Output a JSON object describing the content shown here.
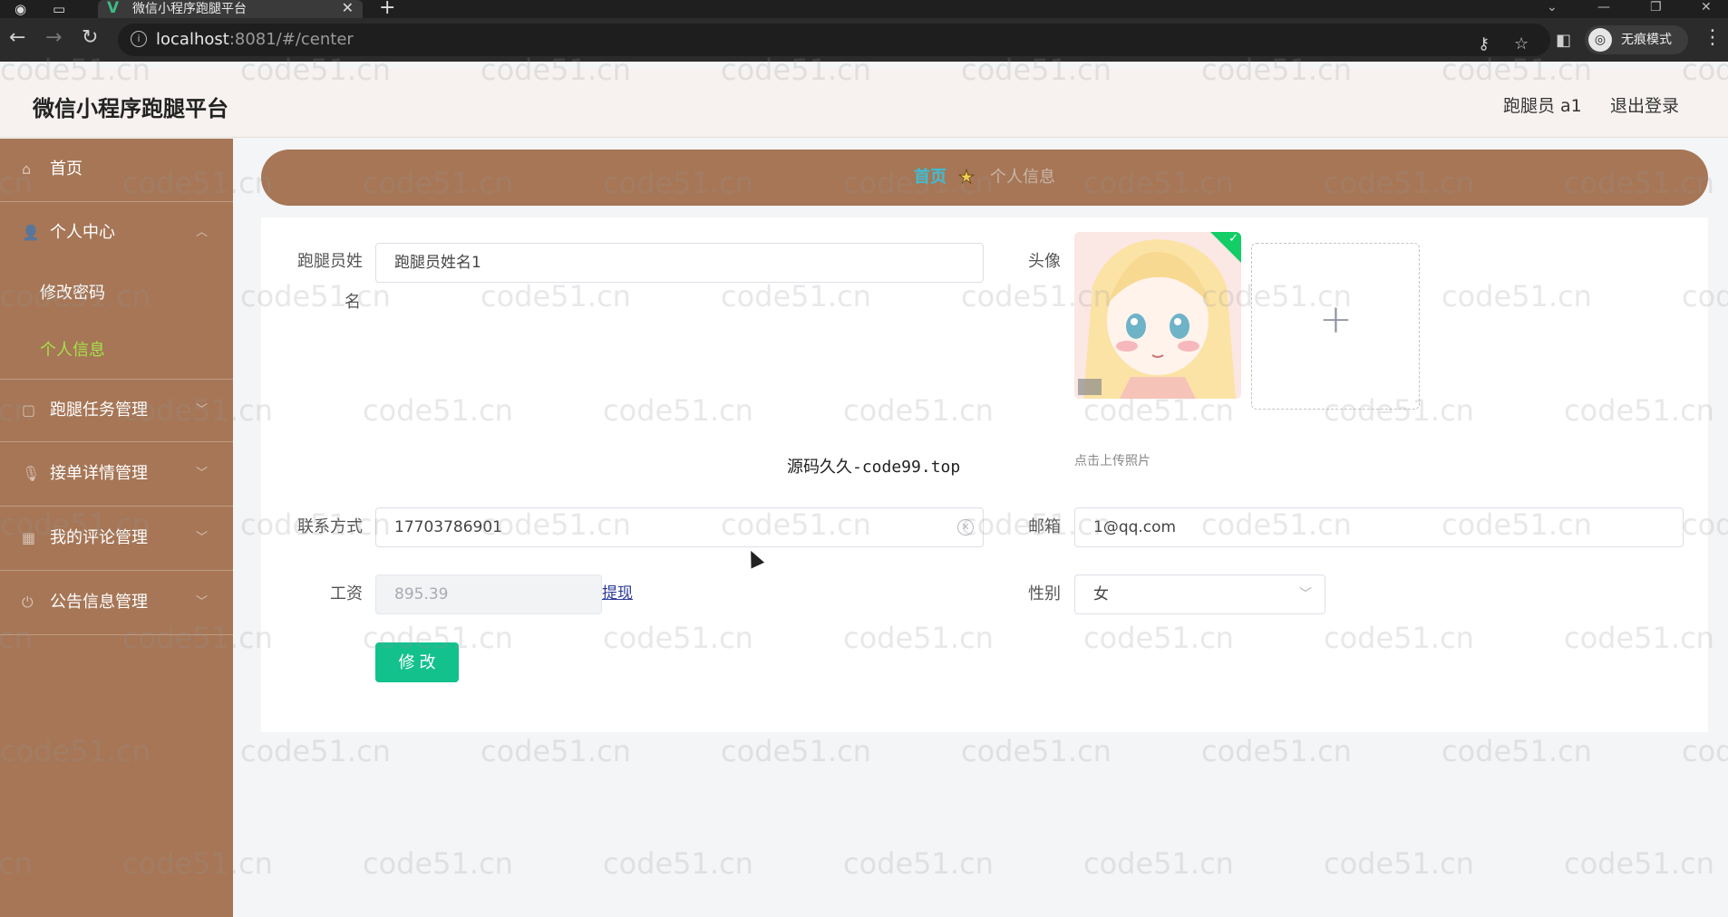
{
  "browser": {
    "tab_title": "微信小程序跑腿平台",
    "url_host": "localhost",
    "url_rest": ":8081/#/center",
    "incognito_label": "无痕模式"
  },
  "header": {
    "title": "微信小程序跑腿平台",
    "user": "跑腿员 a1",
    "logout": "退出登录"
  },
  "sidebar": {
    "items": [
      {
        "label": "首页",
        "icon": "home-icon"
      },
      {
        "label": "个人中心",
        "icon": "user-icon"
      },
      {
        "label": "跑腿任务管理",
        "icon": "task-icon"
      },
      {
        "label": "接单详情管理",
        "icon": "order-icon"
      },
      {
        "label": "我的评论管理",
        "icon": "comment-icon"
      },
      {
        "label": "公告信息管理",
        "icon": "notice-icon"
      }
    ],
    "submenu": [
      {
        "label": "修改密码"
      },
      {
        "label": "个人信息"
      }
    ]
  },
  "breadcrumb": {
    "home": "首页",
    "current": "个人信息"
  },
  "form": {
    "name_label_1": "跑腿员姓",
    "name_label_2": "名",
    "name_value": "跑腿员姓名1",
    "avatar_label": "头像",
    "upload_hint": "点击上传照片",
    "phone_label": "联系方式",
    "phone_value": "17703786901",
    "email_label": "邮箱",
    "email_value": "1@qq.com",
    "salary_label": "工资",
    "salary_value": "895.39",
    "withdraw": "提现",
    "gender_label": "性别",
    "gender_value": "女",
    "submit": "修 改"
  },
  "overlay_text": "源码久久-code99.top",
  "watermark": "code51.cn",
  "colors": {
    "sidebar": "#a67656",
    "active_submenu": "#a5e04a",
    "breadcrumb_home": "#38c0d8",
    "submit": "#13c18d"
  }
}
